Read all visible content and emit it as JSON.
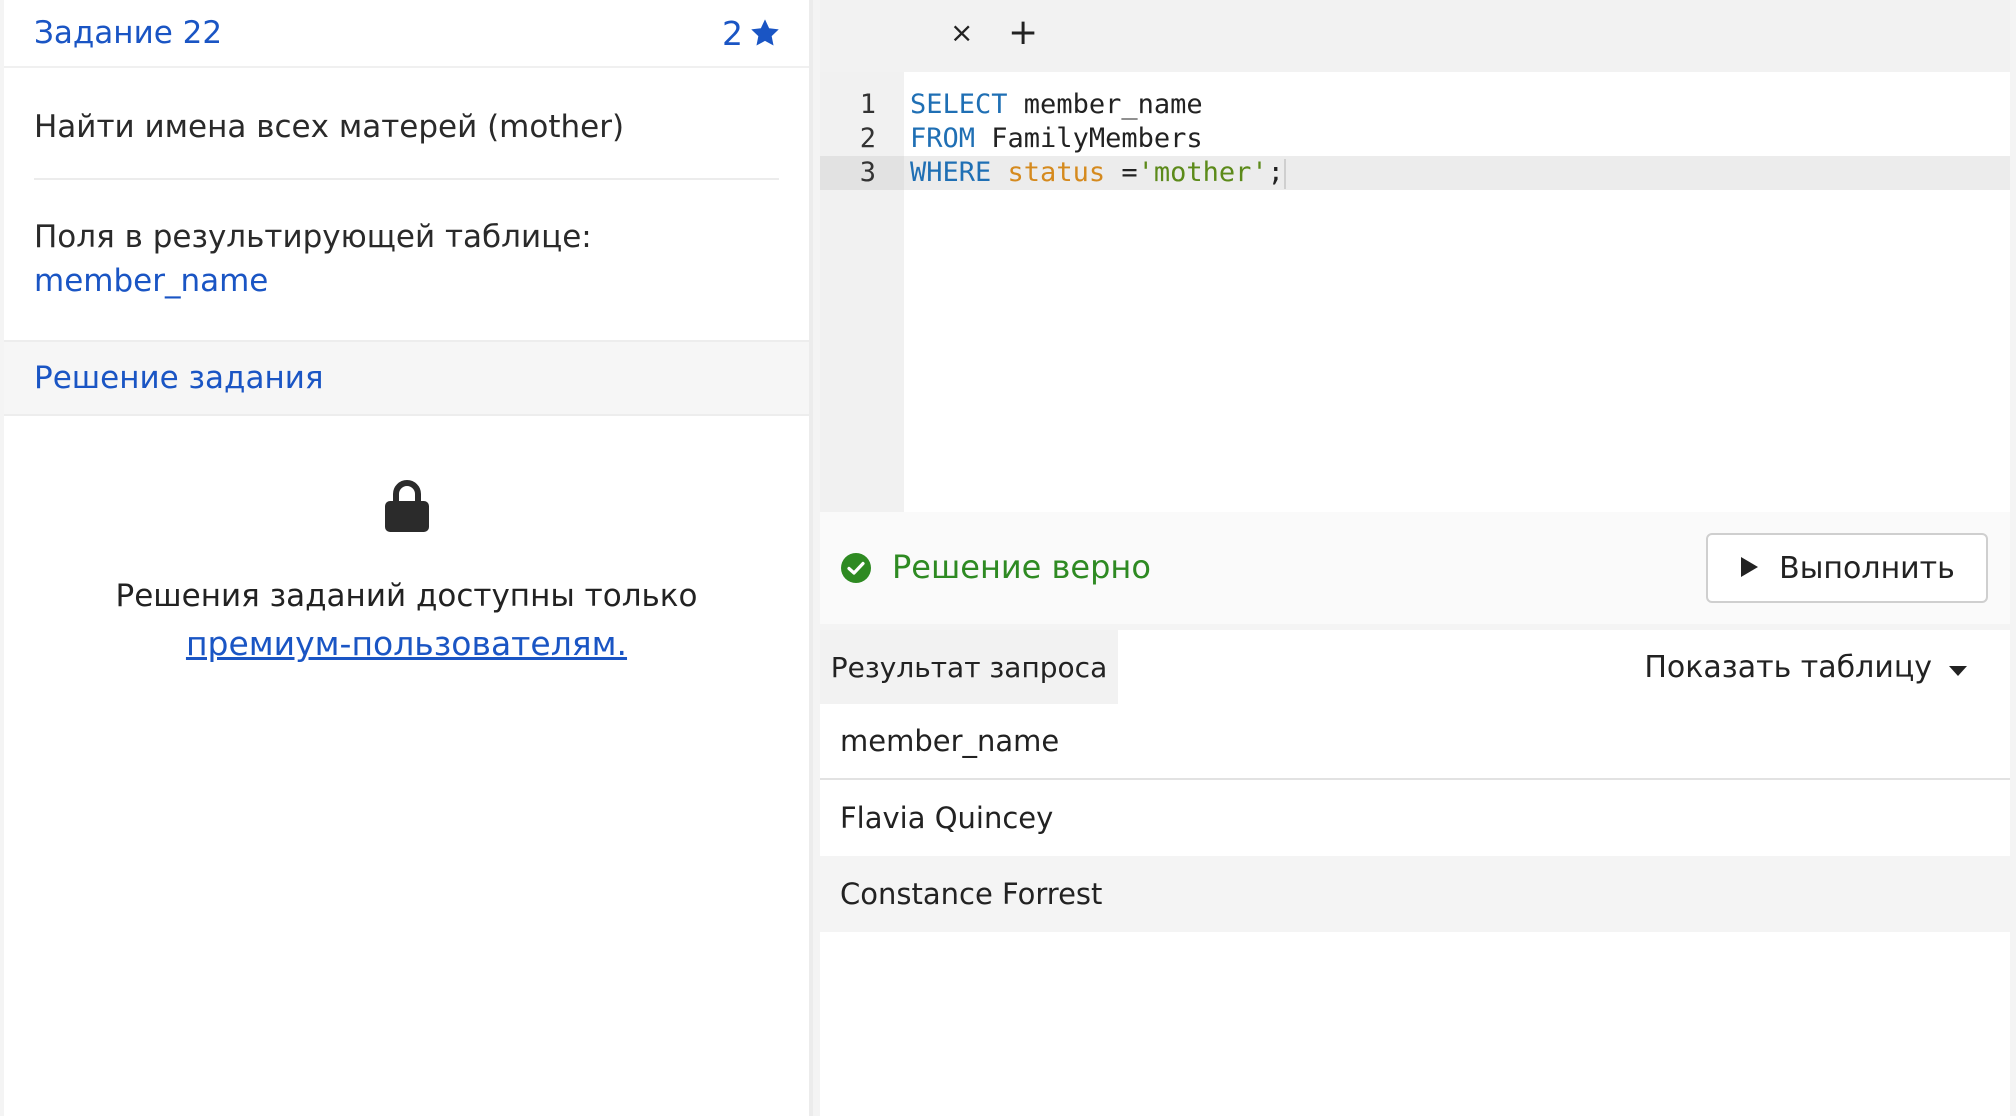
{
  "task": {
    "title": "Задание 22",
    "rating": "2",
    "description": "Найти имена всех матерей (mother)",
    "fields_label": "Поля в результирующей таблице:",
    "fields_value": "member_name",
    "solution_link": "Решение задания",
    "premium_text": "Решения заданий доступны только",
    "premium_link": "премиум-пользователям."
  },
  "editor": {
    "tab_close": "×",
    "tab_add": "+",
    "lines": [
      {
        "num": "1",
        "kw": "SELECT",
        "rest": " member_name"
      },
      {
        "num": "2",
        "kw": "FROM",
        "rest": " FamilyMembers"
      },
      {
        "num": "3",
        "kw": "WHERE",
        "ident": "status",
        "op": " =",
        "str": "'mother'",
        "end": ";"
      }
    ]
  },
  "status": {
    "message": "Решение верно",
    "run_label": "Выполнить"
  },
  "results": {
    "tab_label": "Результат запроса",
    "show_table_label": "Показать таблицу",
    "columns": [
      "member_name"
    ],
    "rows": [
      [
        "Flavia Quincey"
      ],
      [
        "Constance Forrest"
      ]
    ]
  },
  "colors": {
    "link_blue": "#1a55c4",
    "success_green": "#2e8a22",
    "keyword_blue": "#1f6fb4",
    "identifier_orange": "#d58a1e",
    "string_green": "#5c8a1a"
  },
  "icons": {
    "rating": "star-icon",
    "lock": "lock-icon",
    "status": "check-circle-icon",
    "run": "play-icon",
    "dropdown": "caret-down-icon"
  }
}
